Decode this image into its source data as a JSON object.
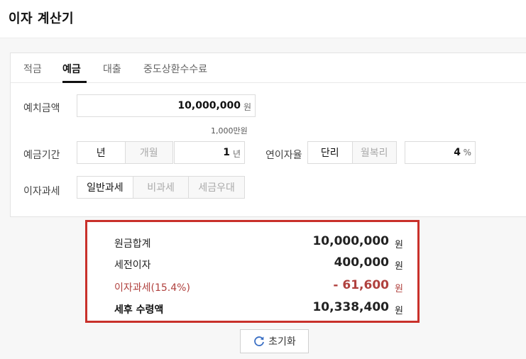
{
  "app": {
    "title": "이자 계산기"
  },
  "tabs": [
    {
      "label": "적금",
      "active": false
    },
    {
      "label": "예금",
      "active": true
    },
    {
      "label": "대출",
      "active": false
    },
    {
      "label": "중도상환수수료",
      "active": false
    }
  ],
  "deposit": {
    "label": "예치금액",
    "value": "10,000,000",
    "unit": "원",
    "hint": "1,000만원"
  },
  "period": {
    "label": "예금기간",
    "options": [
      {
        "label": "년",
        "selected": true
      },
      {
        "label": "개월",
        "selected": false
      }
    ],
    "value": "1",
    "unit": "년"
  },
  "rate": {
    "label": "연이자율",
    "options": [
      {
        "label": "단리",
        "selected": true
      },
      {
        "label": "월복리",
        "selected": false
      }
    ],
    "value": "4",
    "unit": "%"
  },
  "taxation": {
    "label": "이자과세",
    "options": [
      {
        "label": "일반과세",
        "selected": true
      },
      {
        "label": "비과세",
        "selected": false
      },
      {
        "label": "세금우대",
        "selected": false
      }
    ]
  },
  "results": {
    "principal": {
      "label": "원금합계",
      "value": "10,000,000",
      "unit": "원"
    },
    "pretax_interest": {
      "label": "세전이자",
      "value": "400,000",
      "unit": "원"
    },
    "tax": {
      "label": "이자과세(15.4%)",
      "value": "- 61,600",
      "unit": "원"
    },
    "net": {
      "label": "세후 수령액",
      "value": "10,338,400",
      "unit": "원"
    }
  },
  "reset": {
    "label": "초기화",
    "icon": "refresh-icon"
  },
  "colors": {
    "highlight_border": "#c9312b",
    "tax_text": "#b0413e",
    "refresh_icon": "#3a6fc4"
  }
}
